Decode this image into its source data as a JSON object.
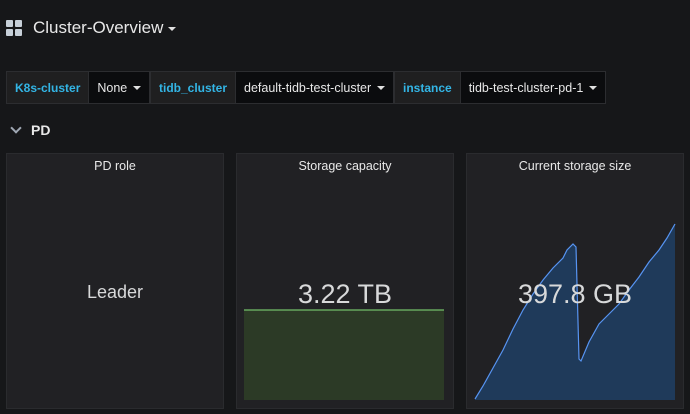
{
  "header": {
    "title": "Cluster-Overview",
    "icons": [
      "dashboard-grid-icon",
      "caret-down-icon"
    ]
  },
  "variables": [
    {
      "label": "K8s-cluster",
      "value": "None"
    },
    {
      "label": "tidb_cluster",
      "value": "default-tidb-test-cluster"
    },
    {
      "label": "instance",
      "value": "tidb-test-cluster-pd-1"
    }
  ],
  "row": {
    "title": "PD",
    "icon": "chevron-down-icon"
  },
  "panels": [
    {
      "title": "PD role",
      "value": "Leader"
    },
    {
      "title": "Storage capacity",
      "value": "3.22 TB"
    },
    {
      "title": "Current storage size",
      "value": "397.8 GB"
    }
  ],
  "colors": {
    "background": "#161719",
    "panel": "#212124",
    "variable_label": "#33b5e5",
    "capacity_fill": "#2c3a26",
    "capacity_line": "#73bf69",
    "size_fill": "#1f3a5a",
    "size_line": "#5794f2"
  }
}
